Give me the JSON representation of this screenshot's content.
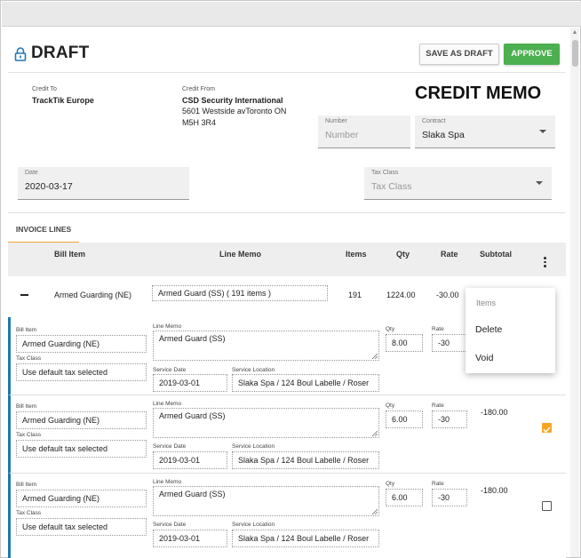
{
  "header": {
    "title": "DRAFT",
    "save_draft": "SAVE AS DRAFT",
    "approve": "APPROVE"
  },
  "document_title": "CREDIT MEMO",
  "credit_to": {
    "label": "Credit To",
    "name": "TrackTik Europe"
  },
  "credit_from": {
    "label": "Credit From",
    "name": "CSD Security International",
    "address_line1": "5601 Westside avToronto ON",
    "address_line2": "M5H 3R4"
  },
  "number": {
    "label": "Number",
    "placeholder": "Number"
  },
  "contract": {
    "label": "Contract",
    "value": "Slaka Spa"
  },
  "date": {
    "label": "Date",
    "value": "2020-03-17"
  },
  "tax_class": {
    "label": "Tax Class",
    "placeholder": "Tax Class"
  },
  "tab": {
    "label": "INVOICE LINES"
  },
  "columns": {
    "bill_item": "Bill Item",
    "line_memo": "Line Memo",
    "items": "Items",
    "qty": "Qty",
    "rate": "Rate",
    "subtotal": "Subtotal"
  },
  "summary": {
    "bill_item": "Armed Guarding (NE)",
    "line_memo": "Armed Guard (SS) ( 191 items )",
    "items": "191",
    "qty": "1224.00",
    "rate": "-30.00"
  },
  "detail_labels": {
    "bill_item": "Bill Item",
    "line_memo": "Line Memo",
    "qty": "Qty",
    "rate": "Rate",
    "tax_class": "Tax Class",
    "service_date": "Service Date",
    "service_location": "Service Location"
  },
  "lines": [
    {
      "bill_item": "Armed Guarding (NE)",
      "memo": "Armed Guard (SS)",
      "qty": "8.00",
      "rate": "-30",
      "subtotal": "",
      "tax": "Use default tax selected",
      "service_date": "2019-03-01",
      "location": "Slaka Spa / 124 Boul Labelle / Roser",
      "checked": false
    },
    {
      "bill_item": "Armed Guarding (NE)",
      "memo": "Armed Guard (SS)",
      "qty": "6.00",
      "rate": "-30",
      "subtotal": "-180.00",
      "tax": "Use default tax selected",
      "service_date": "2019-03-01",
      "location": "Slaka Spa / 124 Boul Labelle / Roser",
      "checked": true
    },
    {
      "bill_item": "Armed Guarding (NE)",
      "memo": "Armed Guard (SS)",
      "qty": "6.00",
      "rate": "-30",
      "subtotal": "-180.00",
      "tax": "Use default tax selected",
      "service_date": "2019-03-01",
      "location": "Slaka Spa / 124 Boul Labelle / Roser",
      "checked": false
    }
  ],
  "menu": {
    "header": "Items",
    "delete": "Delete",
    "void": "Void"
  },
  "colors": {
    "approve": "#4caf50",
    "accent_orange": "#f0a53b",
    "line_bar": "#1f77b4"
  }
}
